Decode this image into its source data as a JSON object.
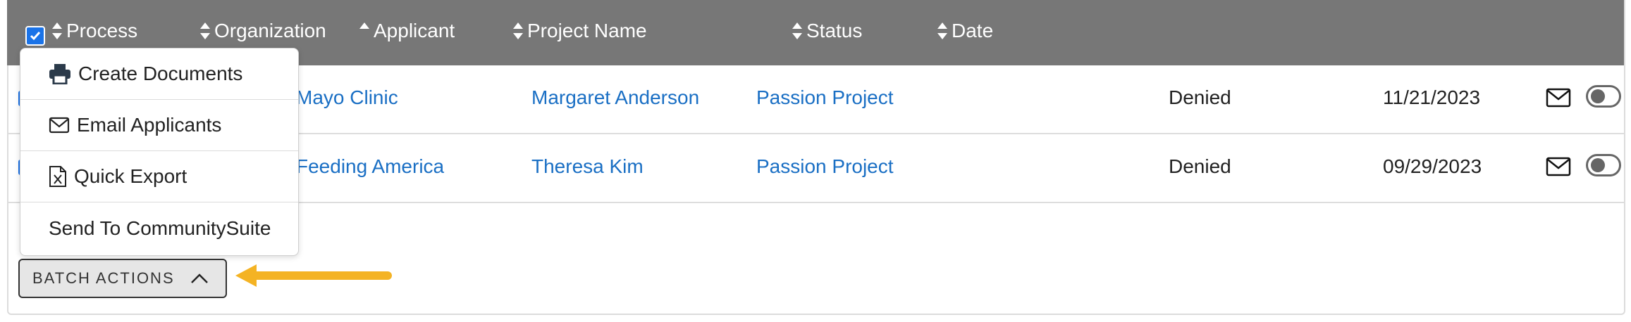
{
  "table": {
    "headers": [
      {
        "label": "Process",
        "sort": "both"
      },
      {
        "label": "Organization",
        "sort": "both"
      },
      {
        "label": "Applicant",
        "sort": "asc"
      },
      {
        "label": "Project Name",
        "sort": "both"
      },
      {
        "label": "Status",
        "sort": "both"
      },
      {
        "label": "Date",
        "sort": "both"
      }
    ],
    "rows": [
      {
        "organization": "Mayo Clinic",
        "applicant": "Margaret Anderson",
        "project": "Passion Project",
        "status": "Denied",
        "date": "11/21/2023"
      },
      {
        "organization": "Feeding America",
        "applicant": "Theresa Kim",
        "project": "Passion Project",
        "status": "Denied",
        "date": "09/29/2023"
      }
    ]
  },
  "batch_menu": {
    "items": [
      {
        "label": "Create Documents",
        "icon": "printer-icon"
      },
      {
        "label": "Email Applicants",
        "icon": "envelope-icon"
      },
      {
        "label": "Quick Export",
        "icon": "excel-file-icon"
      },
      {
        "label": "Send To CommunitySuite",
        "icon": ""
      }
    ]
  },
  "batch_button": {
    "label": "BATCH ACTIONS",
    "icon": "chevron-up-icon"
  },
  "colors": {
    "header_bg": "#777777",
    "link": "#1a6fc4",
    "accent": "#1a73e8",
    "arrow": "#f4b324"
  }
}
